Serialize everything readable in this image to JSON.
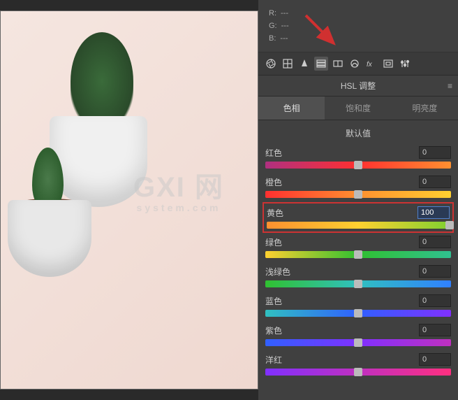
{
  "rgb": {
    "r_label": "R:",
    "r_val": "---",
    "g_label": "G:",
    "g_val": "---",
    "b_label": "B:",
    "b_val": "---"
  },
  "panel_title": "HSL 调整",
  "tabs": {
    "hue": "色相",
    "saturation": "饱和度",
    "lightness": "明亮度"
  },
  "defaults_label": "默认值",
  "sliders": {
    "red": {
      "label": "红色",
      "value": "0"
    },
    "orange": {
      "label": "橙色",
      "value": "0"
    },
    "yellow": {
      "label": "黄色",
      "value": "100"
    },
    "green": {
      "label": "绿色",
      "value": "0"
    },
    "ltgreen": {
      "label": "浅绿色",
      "value": "0"
    },
    "blue": {
      "label": "蓝色",
      "value": "0"
    },
    "purple": {
      "label": "紫色",
      "value": "0"
    },
    "magenta": {
      "label": "洋红",
      "value": "0"
    }
  },
  "watermark": {
    "main": "GXI 网",
    "sub": "system.com"
  }
}
